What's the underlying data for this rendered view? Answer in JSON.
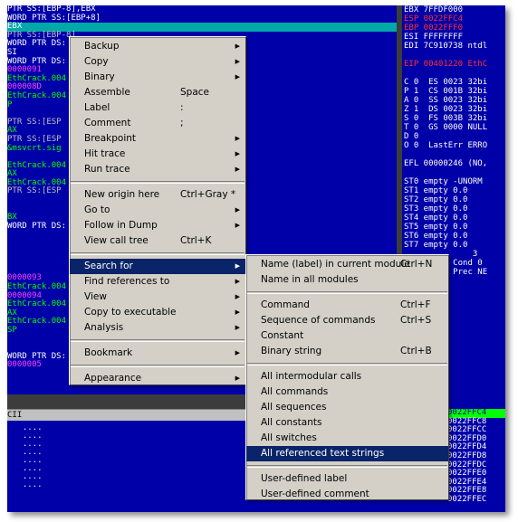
{
  "disasm_lines": [
    {
      "text": "PTR SS:[EBP-8],EBX",
      "c": ""
    },
    {
      "text": "WORD PTR SS:[EBP+8]",
      "c": ""
    },
    {
      "text": "EBX",
      "c": "teal"
    },
    {
      "text": "PTR SS:[EBP-8]",
      "c": "dk"
    },
    {
      "text": "WORD PTR DS:",
      "c": ""
    },
    {
      "text": "SI",
      "c": ""
    },
    {
      "text": "WORD PTR DS:",
      "c": ""
    },
    {
      "text": "0000091",
      "c": "mag"
    },
    {
      "text": "EthCrack.004",
      "c": "green"
    },
    {
      "text": "000008D",
      "c": "mag"
    },
    {
      "text": "EthCrack.004",
      "c": "green"
    },
    {
      "text": "P",
      "c": "green"
    },
    {
      "text": "",
      "c": ""
    },
    {
      "text": "PTR SS:[ESP",
      "c": "dk"
    },
    {
      "text": "AX",
      "c": "green"
    },
    {
      "text": "PTR SS:[ESP",
      "c": "dk"
    },
    {
      "text": "&msvcrt.sig",
      "c": "green"
    },
    {
      "text": "",
      "c": ""
    },
    {
      "text": "EthCrack.004",
      "c": "green"
    },
    {
      "text": "AX",
      "c": "green"
    },
    {
      "text": "EthCrack.004",
      "c": "green"
    },
    {
      "text": "PTR SS:[ESP",
      "c": "dk"
    },
    {
      "text": "",
      "c": ""
    },
    {
      "text": "",
      "c": ""
    },
    {
      "text": "BX",
      "c": "green"
    },
    {
      "text": "WORD PTR DS:",
      "c": ""
    },
    {
      "text": "",
      "c": ""
    },
    {
      "text": "",
      "c": ""
    },
    {
      "text": "",
      "c": ""
    },
    {
      "text": "",
      "c": ""
    },
    {
      "text": "",
      "c": ""
    },
    {
      "text": "0000093",
      "c": "mag"
    },
    {
      "text": "EthCrack.004",
      "c": "green"
    },
    {
      "text": "0000094",
      "c": "mag"
    },
    {
      "text": "EthCrack.004",
      "c": "green"
    },
    {
      "text": "AX",
      "c": "green"
    },
    {
      "text": "EthCrack.004",
      "c": "green"
    },
    {
      "text": "SP",
      "c": "green"
    },
    {
      "text": "",
      "c": ""
    },
    {
      "text": "",
      "c": ""
    },
    {
      "text": "WORD PTR DS:",
      "c": ""
    },
    {
      "text": "0000005",
      "c": "mag"
    }
  ],
  "registers": [
    {
      "text": "EBX 7FFDF000",
      "c": ""
    },
    {
      "text": "ESP 0022FFC4",
      "c": "red"
    },
    {
      "text": "EBP 0022FFF0",
      "c": "red"
    },
    {
      "text": "ESI FFFFFFFF",
      "c": ""
    },
    {
      "text": "EDI 7C910738 ntdl",
      "c": ""
    },
    {
      "text": "",
      "c": ""
    },
    {
      "text": "EIP 00401220 EthC",
      "c": "red"
    },
    {
      "text": "",
      "c": ""
    },
    {
      "text": "C 0  ES 0023 32bi",
      "c": ""
    },
    {
      "text": "P 1  CS 001B 32bi",
      "c": ""
    },
    {
      "text": "A 0  SS 0023 32bi",
      "c": ""
    },
    {
      "text": "Z 1  DS 0023 32bi",
      "c": ""
    },
    {
      "text": "S 0  FS 003B 32bi",
      "c": ""
    },
    {
      "text": "T 0  GS 0000 NULL",
      "c": ""
    },
    {
      "text": "D 0",
      "c": ""
    },
    {
      "text": "O 0  LastErr ERRO",
      "c": ""
    },
    {
      "text": "",
      "c": ""
    },
    {
      "text": "EFL 00000246 (NO,",
      "c": ""
    },
    {
      "text": "",
      "c": ""
    },
    {
      "text": "ST0 empty -UNORM",
      "c": ""
    },
    {
      "text": "ST1 empty 0.0",
      "c": ""
    },
    {
      "text": "ST2 empty 0.0",
      "c": ""
    },
    {
      "text": "ST3 empty 0.0",
      "c": ""
    },
    {
      "text": "ST4 empty 0.0",
      "c": ""
    },
    {
      "text": "ST5 empty 0.0",
      "c": ""
    },
    {
      "text": "ST6 empty 0.0",
      "c": ""
    },
    {
      "text": "ST7 empty 0.0",
      "c": ""
    },
    {
      "text": "              3",
      "c": ""
    },
    {
      "text": "FST 0000  Cond 0",
      "c": ""
    },
    {
      "text": "FCW 027F  Prec NE",
      "c": ""
    }
  ],
  "dump": {
    "header": "CII",
    "dots": "  ....\n  ....\n  ....\n  ....\n  ....\n  ....\n  ....\n  ...."
  },
  "stack": [
    {
      "text": "0022FFC4",
      "hl": true
    },
    {
      "text": "0022FFC8",
      "hl": false
    },
    {
      "text": "0022FFCC",
      "hl": false
    },
    {
      "text": "0022FFD0",
      "hl": false
    },
    {
      "text": "0022FFD4",
      "hl": false
    },
    {
      "text": "0022FFD8",
      "hl": false
    },
    {
      "text": "0022FFDC",
      "hl": false
    },
    {
      "text": "0022FFE0",
      "hl": false
    },
    {
      "text": "0022FFE4",
      "hl": false
    },
    {
      "text": "0022FFE8",
      "hl": false
    },
    {
      "text": "0022FFEC",
      "hl": false
    }
  ],
  "menu": {
    "backup": "Backup",
    "copy": "Copy",
    "binary": "Binary",
    "assemble": "Assemble",
    "assemble_key": "Space",
    "label": "Label",
    "label_key": ":",
    "comment": "Comment",
    "comment_key": ";",
    "breakpoint": "Breakpoint",
    "hit_trace": "Hit trace",
    "run_trace": "Run trace",
    "new_origin": "New origin here",
    "new_origin_key": "Ctrl+Gray *",
    "go_to": "Go to",
    "follow_dump": "Follow in Dump",
    "view_call_tree": "View call tree",
    "view_call_tree_key": "Ctrl+K",
    "search_for": "Search for",
    "find_refs": "Find references to",
    "view": "View",
    "copy_exec": "Copy to executable",
    "analysis": "Analysis",
    "bookmark": "Bookmark",
    "appearance": "Appearance"
  },
  "submenu": {
    "name_label": "Name (label) in current module",
    "name_label_key": "Ctrl+N",
    "name_all": "Name in all modules",
    "command": "Command",
    "command_key": "Ctrl+F",
    "seq_commands": "Sequence of commands",
    "seq_commands_key": "Ctrl+S",
    "constant": "Constant",
    "binary_string": "Binary string",
    "binary_string_key": "Ctrl+B",
    "all_intermodular": "All intermodular calls",
    "all_commands": "All commands",
    "all_sequences": "All sequences",
    "all_constants": "All constants",
    "all_switches": "All switches",
    "all_ref_text": "All referenced text strings",
    "user_label": "User-defined label",
    "user_comment": "User-defined comment"
  }
}
